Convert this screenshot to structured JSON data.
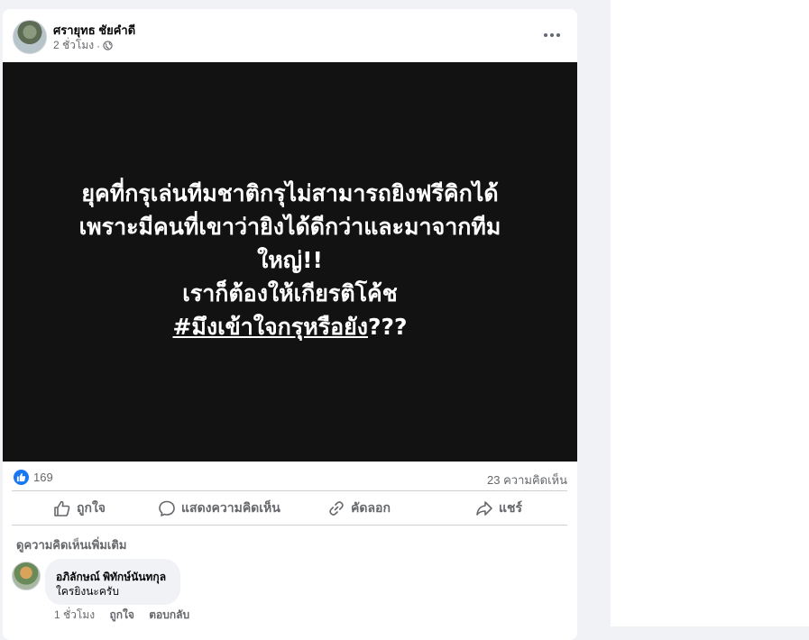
{
  "post": {
    "author": "ศรายุทธ ชัยคำดี",
    "time": "2 ชั่วโมง",
    "separator": "·",
    "image_text": {
      "line1": "ยุคที่กรุเล่นทีมชาติกรุไม่สามารถยิงฟรีคิกได้",
      "line2": "เพราะมีคนที่เขาว่ายิงได้ดีกว่าและมาจากทีม",
      "line3": "ใหญ่!!",
      "line4": "เราก็ต้องให้เกียรติโค้ช",
      "hashtag": "#มึงเข้าใจกรุหรือยัง",
      "hashtag_suffix": "???"
    },
    "like_count": "169",
    "comment_count": "23 ความคิดเห็น"
  },
  "actions": {
    "like": "ถูกใจ",
    "comment": "แสดงความคิดเห็น",
    "copy": "คัดลอก",
    "share": "แชร์"
  },
  "comments": {
    "more_label": "ดูความคิดเห็นเพิ่มเติม",
    "items": [
      {
        "author": "อภิลักษณ์ พิทักษ์นันทกุล",
        "text": "ใครยิงนะครับ",
        "time": "1 ชั่วโมง",
        "like_label": "ถูกใจ",
        "reply_label": "ตอบกลับ"
      }
    ]
  },
  "colors": {
    "accent": "#1877f2",
    "image_bg": "#121212",
    "page_bg": "#f0f2f5"
  },
  "icons": [
    "globe-icon",
    "more-icon",
    "like-reaction-icon",
    "like-icon",
    "comment-icon",
    "link-icon",
    "share-icon"
  ]
}
